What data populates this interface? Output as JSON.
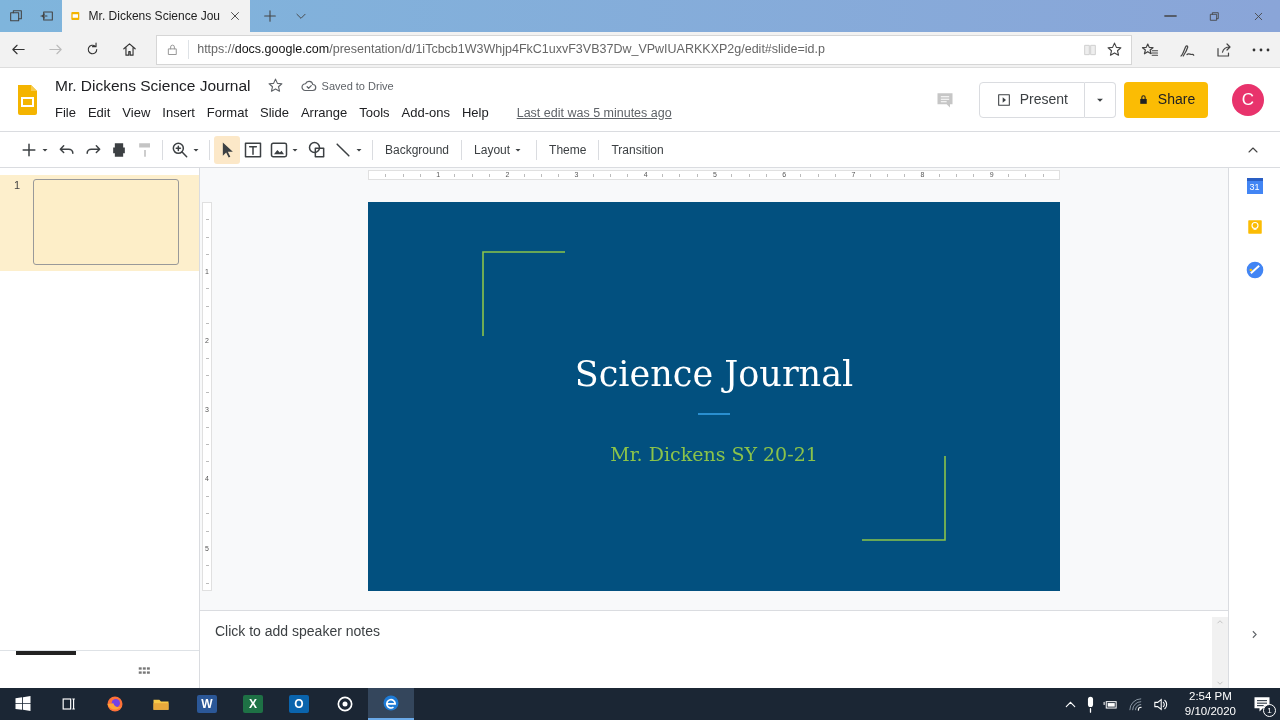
{
  "browser": {
    "tabs": [
      {
        "title": "Mr. Dickens Science Jou",
        "selected": true
      }
    ],
    "nav": [
      {
        "kind": "back",
        "disabled": false
      },
      {
        "kind": "forward",
        "disabled": true
      },
      {
        "kind": "refresh",
        "disabled": false
      },
      {
        "kind": "home",
        "disabled": false
      }
    ],
    "url": {
      "scheme": "https://",
      "domain": "docs.google.com",
      "path": "/presentation/d/1iTcbcb1W3Whjp4FkC1uxvF3VB37Dw_VPwIUARKKXP2g/edit#slide=id.p"
    }
  },
  "document": {
    "title": "Mr. Dickens Science Journal",
    "save_status": "Saved to Drive",
    "menu": [
      "File",
      "Edit",
      "View",
      "Insert",
      "Format",
      "Slide",
      "Arrange",
      "Tools",
      "Add-ons",
      "Help"
    ],
    "last_edit": "Last edit was 5 minutes ago",
    "present": "Present",
    "share": "Share",
    "avatar": "C"
  },
  "toolbar": [
    {
      "kind": "add",
      "dropdown": true,
      "disabled": false,
      "selected": false
    },
    {
      "kind": "undo",
      "dropdown": false,
      "disabled": false,
      "selected": false
    },
    {
      "kind": "redo",
      "dropdown": false,
      "disabled": false,
      "selected": false
    },
    {
      "kind": "print",
      "dropdown": false,
      "disabled": false,
      "selected": false
    },
    {
      "kind": "paint",
      "dropdown": false,
      "disabled": true,
      "selected": false
    },
    {
      "kind": "separator"
    },
    {
      "kind": "zoom",
      "dropdown": true,
      "disabled": false,
      "selected": false
    },
    {
      "kind": "separator"
    },
    {
      "kind": "select",
      "dropdown": false,
      "disabled": false,
      "selected": true
    },
    {
      "kind": "textbox",
      "dropdown": false,
      "disabled": false,
      "selected": false
    },
    {
      "kind": "image",
      "dropdown": true,
      "disabled": false,
      "selected": false
    },
    {
      "kind": "shape",
      "dropdown": false,
      "disabled": false,
      "selected": false
    },
    {
      "kind": "line",
      "dropdown": true,
      "disabled": false,
      "selected": false
    },
    {
      "kind": "separator"
    },
    {
      "kind": "text",
      "label": "Background",
      "dropdown": false
    },
    {
      "kind": "separator"
    },
    {
      "kind": "text",
      "label": "Layout",
      "dropdown": true
    },
    {
      "kind": "separator"
    },
    {
      "kind": "text",
      "label": "Theme",
      "dropdown": false
    },
    {
      "kind": "separator"
    },
    {
      "kind": "text",
      "label": "Transition",
      "dropdown": false
    }
  ],
  "filmstrip": [
    {
      "number": "1",
      "selected": true
    }
  ],
  "rulers": {
    "horizontal": [
      "1",
      "2",
      "3",
      "4",
      "5",
      "6",
      "7",
      "8",
      "9"
    ],
    "vertical": [
      "1",
      "2",
      "3",
      "4",
      "5"
    ]
  },
  "slide": {
    "title": "Science Journal",
    "subtitle": "Mr. Dickens SY 20-21"
  },
  "notes": {
    "placeholder": "Click to add speaker notes"
  },
  "side_panel": [
    {
      "kind": "calendar",
      "text": "31"
    },
    {
      "kind": "keep"
    },
    {
      "kind": "tasks"
    }
  ],
  "taskbar": {
    "apps": [
      {
        "kind": "start",
        "active": false
      },
      {
        "kind": "taskview",
        "active": false
      },
      {
        "kind": "firefox",
        "active": false
      },
      {
        "kind": "explorer",
        "active": false
      },
      {
        "kind": "word",
        "letter": "W",
        "active": false
      },
      {
        "kind": "excel",
        "letter": "X",
        "active": false
      },
      {
        "kind": "outlook",
        "letter": "O",
        "active": false
      },
      {
        "kind": "cortana",
        "active": false
      },
      {
        "kind": "edge",
        "active": true
      }
    ],
    "time": "2:54 PM",
    "date": "9/10/2020",
    "notifications": "1"
  }
}
